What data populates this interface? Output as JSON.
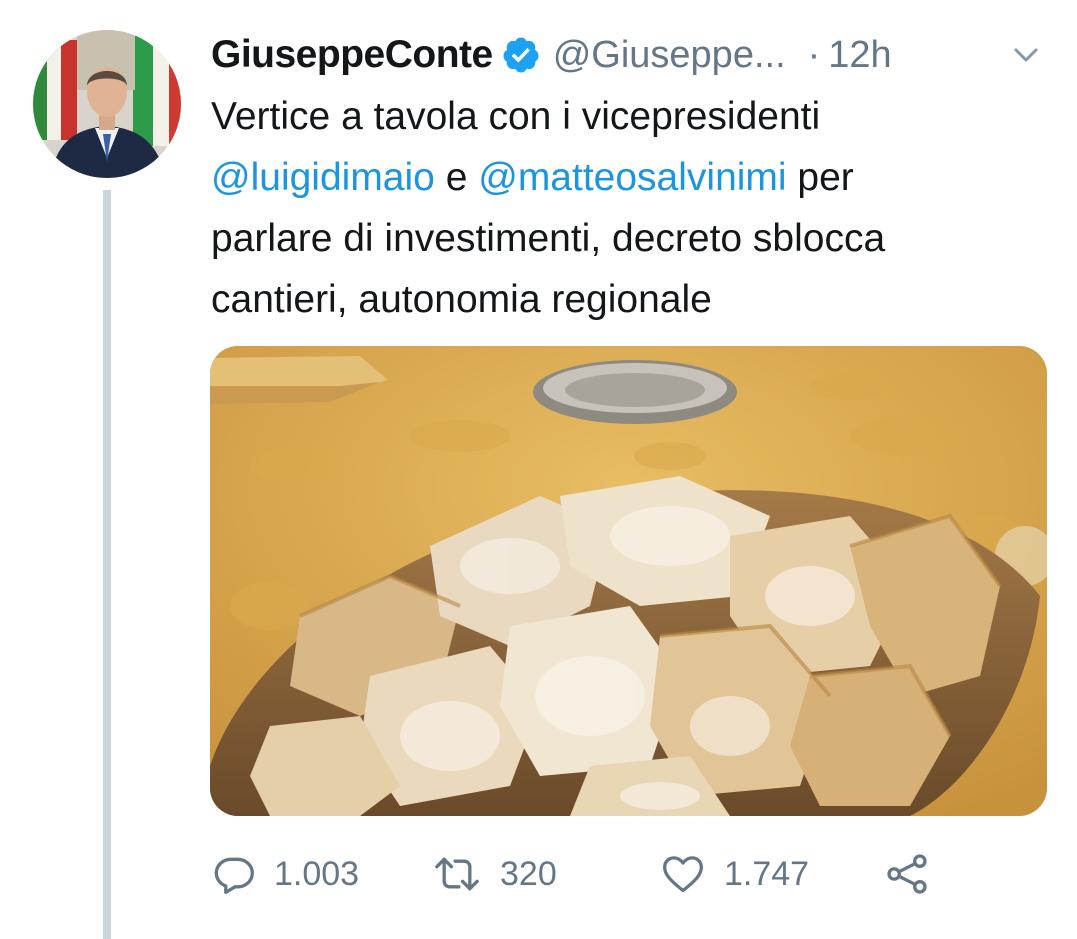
{
  "tweet": {
    "display_name": "GiuseppeConte",
    "handle": "@Giuseppe...",
    "separator": "·",
    "time": "12h",
    "text_line1": "Vertice a tavola con i vicepresidenti",
    "mention1": "@luigidimaio",
    "conj": " e ",
    "mention2": "@matteosalvinimi",
    "after_mentions": " per",
    "text_line3": "parlare di investimenti, decreto sblocca",
    "text_line4": "cantieri, autonomia regionale"
  },
  "actions": {
    "reply_count": "1.003",
    "retweet_count": "320",
    "like_count": "1.747"
  },
  "icons": {
    "verified": "verified-badge-icon",
    "caret": "chevron-down-icon",
    "reply": "reply-icon",
    "retweet": "retweet-icon",
    "like": "heart-icon",
    "share": "share-icon"
  },
  "colors": {
    "link": "#1b95e0",
    "muted": "#657786",
    "text": "#14171a",
    "thread_line": "#ccd6dd"
  }
}
